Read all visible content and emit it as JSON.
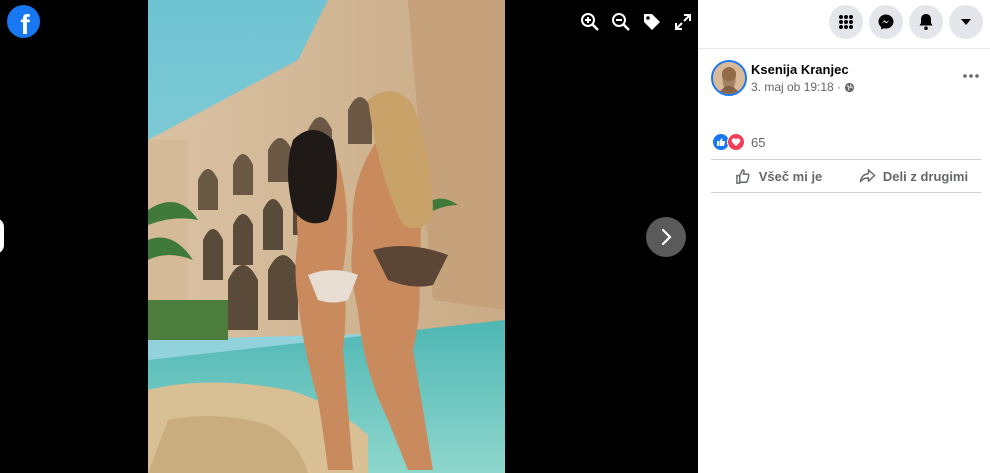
{
  "app": {
    "logo_letter": "f",
    "brand_color": "#1877f2"
  },
  "viewer": {
    "tools": [
      {
        "icon": "zoom-in-icon"
      },
      {
        "icon": "zoom-out-icon"
      },
      {
        "icon": "tag-icon"
      },
      {
        "icon": "fullscreen-icon"
      }
    ],
    "next_icon": "chevron-right-icon"
  },
  "topbar": {
    "buttons": [
      "menu-grid-icon",
      "messenger-icon",
      "notifications-bell-icon",
      "account-caret-icon"
    ]
  },
  "post": {
    "author": "Ksenija Kranjec",
    "timestamp": "3. maj ob 19:18 ·",
    "privacy_icon": "globe-icon",
    "reaction_count": "65",
    "reactions": [
      "like-icon",
      "love-icon"
    ]
  },
  "actions": {
    "like_label": "Všeč mi je",
    "share_label": "Deli z drugimi"
  }
}
